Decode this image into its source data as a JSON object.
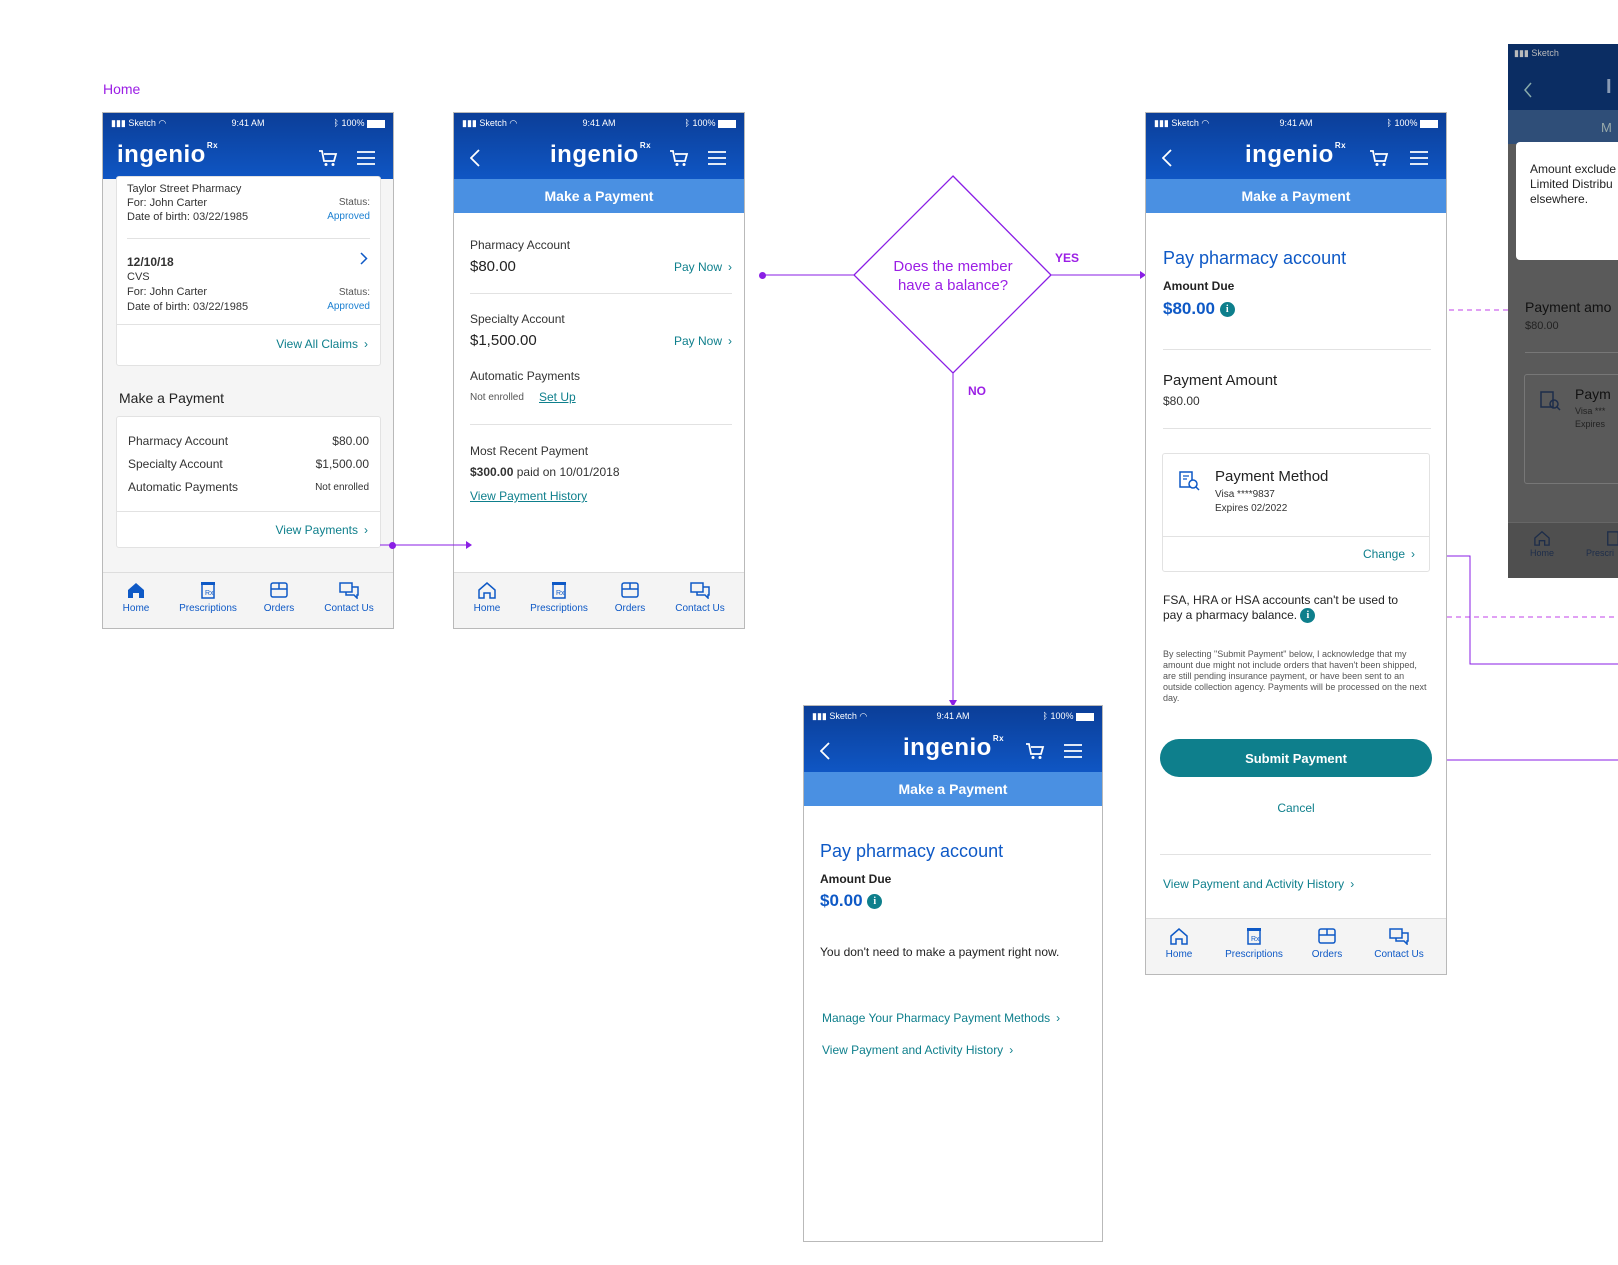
{
  "page_label": "Home",
  "status": {
    "carrier": "Sketch",
    "time": "9:41 AM",
    "battery": "100%"
  },
  "brand": {
    "logo_text": "ingenio",
    "logo_sup": "Rx"
  },
  "tabs": [
    "Home",
    "Prescriptions",
    "Orders",
    "Contact Us"
  ],
  "screen1": {
    "claim1": {
      "pharmacy": "Taylor Street Pharmacy",
      "for": "For: John Carter",
      "dob": "Date of birth: 03/22/1985",
      "status_label": "Status:",
      "status": "Approved"
    },
    "claim2": {
      "date": "12/10/18",
      "pharmacy": "CVS",
      "for": "For: John Carter",
      "dob": "Date of birth: 03/22/1985",
      "status_label": "Status:",
      "status": "Approved"
    },
    "view_all_claims": "View All Claims",
    "section_title": "Make a Payment",
    "rows": [
      {
        "label": "Pharmacy Account",
        "value": "$80.00"
      },
      {
        "label": "Specialty Account",
        "value": "$1,500.00"
      },
      {
        "label": "Automatic Payments",
        "value": "Not enrolled"
      }
    ],
    "view_payments": "View Payments"
  },
  "screen2": {
    "title": "Make a Payment",
    "pharmacy_label": "Pharmacy Account",
    "pharmacy_amount": "$80.00",
    "pay_now": "Pay Now",
    "specialty_label": "Specialty Account",
    "specialty_amount": "$1,500.00",
    "auto_label": "Automatic Payments",
    "auto_status": "Not enrolled",
    "setup": "Set Up",
    "recent_label": "Most Recent Payment",
    "recent_amount": "$300.00",
    "recent_rest": "paid on 10/01/2018",
    "history_link": "View Payment History"
  },
  "decision": {
    "question_line1": "Does the member",
    "question_line2": "have a balance?",
    "yes": "YES",
    "no": "NO"
  },
  "screen3": {
    "title": "Make a Payment",
    "heading": "Pay pharmacy account",
    "amount_due_label": "Amount Due",
    "amount_due": "$0.00",
    "message": "You don't need to make a payment right now.",
    "link1": "Manage Your Pharmacy Payment Methods",
    "link2": "View Payment and Activity History"
  },
  "screen4": {
    "title": "Make a Payment",
    "heading": "Pay pharmacy account",
    "amount_due_label": "Amount Due",
    "amount_due": "$80.00",
    "payment_amount_label": "Payment Amount",
    "payment_amount": "$80.00",
    "method_label": "Payment Method",
    "method_card": "Visa ****9837",
    "method_exp": "Expires 02/2022",
    "change": "Change",
    "fsa_line1": "FSA, HRA or HSA accounts can't be used to",
    "fsa_line2": "pay a pharmacy balance.",
    "legal": "By selecting \"Submit Payment\" below, I acknowledge that my amount due might not include orders that haven't been shipped, are still pending insurance payment, or have been sent to an outside collection agency. Payments will be processed on the next day.",
    "submit": "Submit Payment",
    "cancel": "Cancel",
    "history": "View Payment and Activity History"
  },
  "screen5": {
    "status_carrier": "Sketch",
    "logo_fragment": "I",
    "sub_fragment": "M",
    "tooltip_line1": "Amount exclude",
    "tooltip_line2": "Limited Distribu",
    "tooltip_line3": "elsewhere.",
    "payment_label": "Payment amo",
    "payment_amount": "$80.00",
    "method_label": "Paym",
    "method_card": "Visa ***",
    "method_exp": "Expires",
    "tab_home": "Home",
    "tab_presc": "Prescri"
  },
  "colors": {
    "brand_dark": "#0b3e98",
    "brand_light": "#4a90e2",
    "teal": "#0e7f8c",
    "flow_purple": "#8a1ee5",
    "label_purple": "#9b1ee5"
  }
}
